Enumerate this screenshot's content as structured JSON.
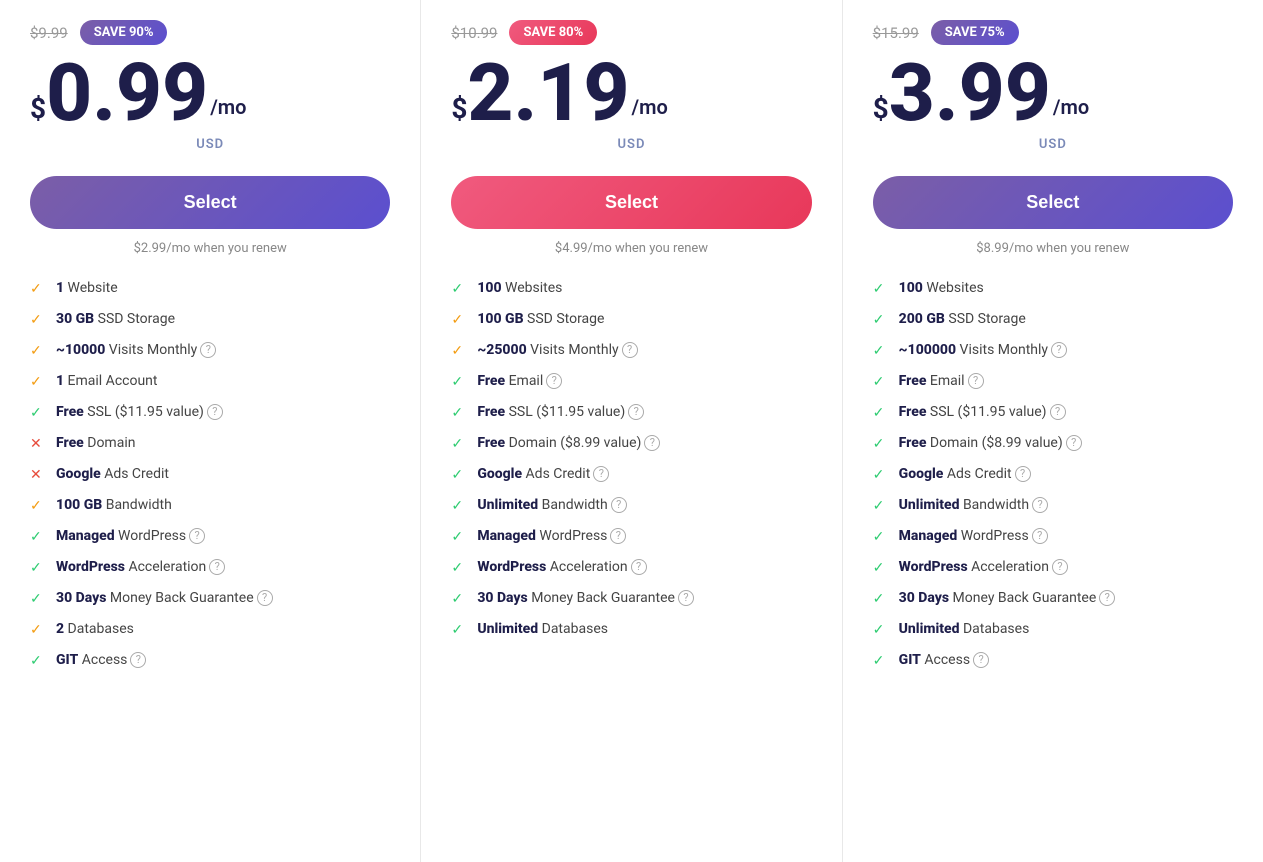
{
  "plans": [
    {
      "id": "basic",
      "originalPrice": "$9.99",
      "saveBadge": "SAVE 90%",
      "saveBadgeStyle": "purple",
      "currencySymbol": "$",
      "mainPrice": "0.99",
      "perMonth": "/mo",
      "usd": "USD",
      "selectLabel": "Select",
      "selectStyle": "purple",
      "renewNote": "$2.99/mo when you renew",
      "features": [
        {
          "icon": "check-orange",
          "bold": "1",
          "text": " Website",
          "info": false
        },
        {
          "icon": "check-orange",
          "bold": "30 GB",
          "text": " SSD Storage",
          "info": false
        },
        {
          "icon": "check-orange",
          "bold": "~10000",
          "text": " Visits Monthly",
          "info": true
        },
        {
          "icon": "check-orange",
          "bold": "1",
          "text": " Email Account",
          "info": false
        },
        {
          "icon": "check-green",
          "bold": "Free",
          "text": " SSL ($11.95 value)",
          "info": true
        },
        {
          "icon": "cross-red",
          "bold": "Free",
          "text": " Domain",
          "info": false
        },
        {
          "icon": "cross-red",
          "bold": "Google",
          "text": " Ads Credit",
          "info": false
        },
        {
          "icon": "check-orange",
          "bold": "100 GB",
          "text": " Bandwidth",
          "info": false
        },
        {
          "icon": "check-green",
          "bold": "Managed",
          "text": " WordPress",
          "info": true
        },
        {
          "icon": "check-green",
          "bold": "WordPress",
          "text": " Acceleration",
          "info": true
        },
        {
          "icon": "check-green",
          "bold": "30 Days",
          "text": " Money Back Guarantee",
          "info": true
        },
        {
          "icon": "check-orange",
          "bold": "2",
          "text": " Databases",
          "info": false
        },
        {
          "icon": "check-green",
          "bold": "GIT",
          "text": " Access",
          "info": true
        }
      ]
    },
    {
      "id": "premium",
      "originalPrice": "$10.99",
      "saveBadge": "SAVE 80%",
      "saveBadgeStyle": "pink",
      "currencySymbol": "$",
      "mainPrice": "2.19",
      "perMonth": "/mo",
      "usd": "USD",
      "selectLabel": "Select",
      "selectStyle": "pink",
      "renewNote": "$4.99/mo when you renew",
      "features": [
        {
          "icon": "check-green",
          "bold": "100",
          "text": " Websites",
          "info": false
        },
        {
          "icon": "check-orange",
          "bold": "100 GB",
          "text": " SSD Storage",
          "info": false
        },
        {
          "icon": "check-orange",
          "bold": "~25000",
          "text": " Visits Monthly",
          "info": true
        },
        {
          "icon": "check-green",
          "bold": "Free",
          "text": " Email",
          "info": true
        },
        {
          "icon": "check-green",
          "bold": "Free",
          "text": " SSL ($11.95 value)",
          "info": true
        },
        {
          "icon": "check-green",
          "bold": "Free",
          "text": " Domain ($8.99 value)",
          "info": true
        },
        {
          "icon": "check-green",
          "bold": "Google",
          "text": " Ads Credit",
          "info": true
        },
        {
          "icon": "check-green",
          "bold": "Unlimited",
          "text": " Bandwidth",
          "info": true
        },
        {
          "icon": "check-green",
          "bold": "Managed",
          "text": " WordPress",
          "info": true
        },
        {
          "icon": "check-green",
          "bold": "WordPress",
          "text": " Acceleration",
          "info": true
        },
        {
          "icon": "check-green",
          "bold": "30 Days",
          "text": " Money Back Guarantee",
          "info": true
        },
        {
          "icon": "check-green",
          "bold": "Unlimited",
          "text": " Databases",
          "info": false
        }
      ]
    },
    {
      "id": "business",
      "originalPrice": "$15.99",
      "saveBadge": "SAVE 75%",
      "saveBadgeStyle": "purple",
      "currencySymbol": "$",
      "mainPrice": "3.99",
      "perMonth": "/mo",
      "usd": "USD",
      "selectLabel": "Select",
      "selectStyle": "purple",
      "renewNote": "$8.99/mo when you renew",
      "features": [
        {
          "icon": "check-green",
          "bold": "100",
          "text": " Websites",
          "info": false
        },
        {
          "icon": "check-green",
          "bold": "200 GB",
          "text": " SSD Storage",
          "info": false
        },
        {
          "icon": "check-green",
          "bold": "~100000",
          "text": " Visits Monthly",
          "info": true
        },
        {
          "icon": "check-green",
          "bold": "Free",
          "text": " Email",
          "info": true
        },
        {
          "icon": "check-green",
          "bold": "Free",
          "text": " SSL ($11.95 value)",
          "info": true
        },
        {
          "icon": "check-green",
          "bold": "Free",
          "text": " Domain ($8.99 value)",
          "info": true
        },
        {
          "icon": "check-green",
          "bold": "Google",
          "text": " Ads Credit",
          "info": true
        },
        {
          "icon": "check-green",
          "bold": "Unlimited",
          "text": " Bandwidth",
          "info": true
        },
        {
          "icon": "check-green",
          "bold": "Managed",
          "text": " WordPress",
          "info": true
        },
        {
          "icon": "check-green",
          "bold": "WordPress",
          "text": " Acceleration",
          "info": true
        },
        {
          "icon": "check-green",
          "bold": "30 Days",
          "text": " Money Back Guarantee",
          "info": true
        },
        {
          "icon": "check-green",
          "bold": "Unlimited",
          "text": " Databases",
          "info": false
        },
        {
          "icon": "check-green",
          "bold": "GIT",
          "text": " Access",
          "info": true
        }
      ]
    }
  ]
}
